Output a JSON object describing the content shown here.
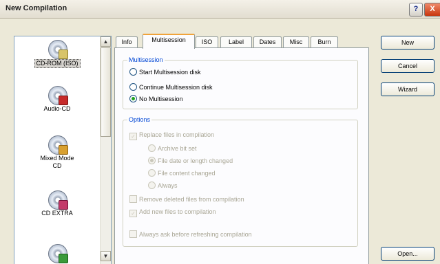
{
  "window": {
    "title": "New Compilation",
    "help": "?",
    "close": "X"
  },
  "types": [
    {
      "label": "CD-ROM (ISO)",
      "icon": "cd-rom-icon",
      "selected": true
    },
    {
      "label": "Audio-CD",
      "icon": "audio-cd-icon"
    },
    {
      "label": "Mixed Mode CD",
      "icon": "mixed-mode-cd-icon"
    },
    {
      "label": "CD EXTRA",
      "icon": "cd-extra-icon"
    },
    {
      "label": "",
      "icon": "cd-icon"
    }
  ],
  "tabs": [
    "Info",
    "Multisession",
    "ISO",
    "Label",
    "Dates",
    "Misc",
    "Burn"
  ],
  "active_tab": "Multisession",
  "multisession": {
    "title": "Multisession",
    "options": [
      "Start Multisession disk",
      "Continue Multisession disk",
      "No Multisession"
    ],
    "selected": "No Multisession"
  },
  "options": {
    "title": "Options",
    "replace_files": "Replace files in compilation",
    "replace_files_checked": true,
    "sub": [
      "Archive bit set",
      "File date or length changed",
      "File content changed",
      "Always"
    ],
    "sub_selected": "File date or length changed",
    "remove_deleted": "Remove deleted files from compilation",
    "add_new": "Add new files to compilation",
    "add_new_checked": true,
    "always_ask": "Always ask before refreshing compilation"
  },
  "buttons": {
    "new": "New",
    "cancel": "Cancel",
    "wizard": "Wizard",
    "open": "Open..."
  },
  "colors": {
    "group_title": "#0046d5",
    "active_tab_accent": "#f0a33a",
    "disabled_text": "#a9a695",
    "radio_dot": "#21a121"
  }
}
